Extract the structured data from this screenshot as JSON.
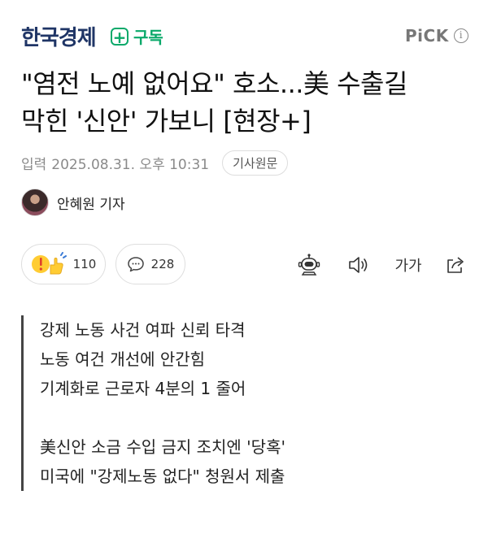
{
  "header": {
    "logo": "한국경제",
    "subscribe_label": "구독",
    "pick_label": "PiCK"
  },
  "article": {
    "headline_line1": "\"염전 노예 없어요\" 호소...美 수출길",
    "headline_line2": "막힌 '신안' 가보니 [현장+]",
    "date_label": "입력",
    "date": "2025.08.31. 오후 10:31",
    "original_button": "기사원문",
    "reporter": "안혜원 기자"
  },
  "actions": {
    "reaction_count": "110",
    "comment_count": "228",
    "font_size_label": "가가"
  },
  "summary": {
    "lines_a": [
      "강제 노동 사건 여파 신뢰 타격",
      "노동 여건 개선에 안간힘",
      "기계화로 근로자 4분의 1 줄어"
    ],
    "lines_b": [
      "美신안 소금 수입 금지 조치엔 '당혹'",
      "미국에 \"강제노동 없다\" 청원서 제출"
    ]
  },
  "colors": {
    "logo": "#1f3566",
    "subscribe": "#0aa96a",
    "summary_bar": "#444444"
  }
}
